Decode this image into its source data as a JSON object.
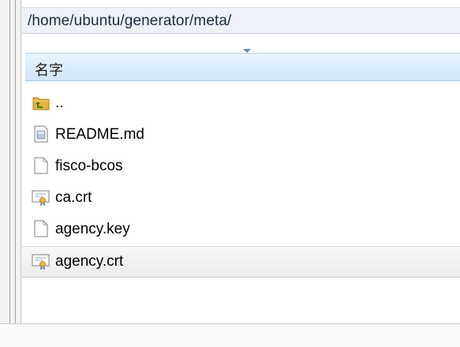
{
  "path_bar": {
    "path": "/home/ubuntu/generator/meta/"
  },
  "header": {
    "name_column": "名字"
  },
  "files": [
    {
      "name": "..",
      "icon": "parent-folder-icon"
    },
    {
      "name": "README.md",
      "icon": "text-file-icon"
    },
    {
      "name": "fisco-bcos",
      "icon": "blank-file-icon"
    },
    {
      "name": "ca.crt",
      "icon": "certificate-icon"
    },
    {
      "name": "agency.key",
      "icon": "blank-file-icon"
    },
    {
      "name": "agency.crt",
      "icon": "certificate-icon"
    }
  ],
  "selected_index": 5,
  "colors": {
    "header_accent": "#cfe6fb",
    "sort_arrow": "#5b8ec8",
    "folder": "#e8b23a",
    "folder_arrow": "#3a7d2c",
    "cert_ribbon": "#2c5db8"
  }
}
